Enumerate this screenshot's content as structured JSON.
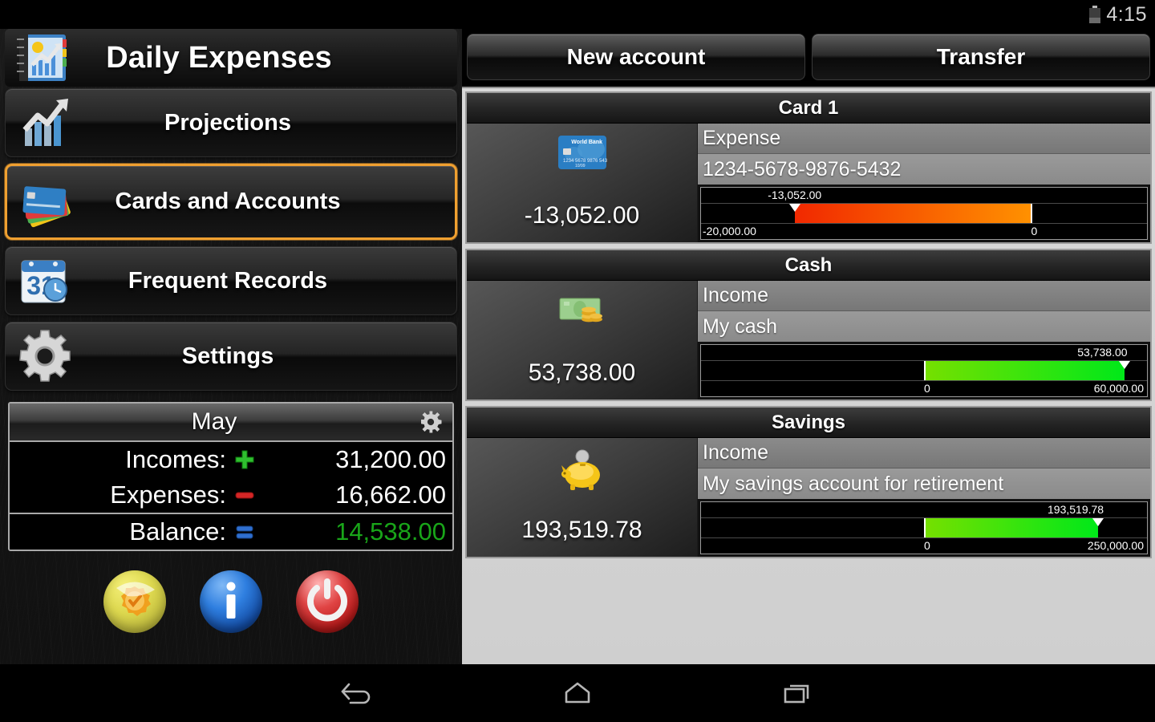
{
  "status_bar": {
    "time": "4:15",
    "battery_icon": "battery-icon"
  },
  "sidebar": {
    "app_title": "Daily Expenses",
    "app_icon": "notebook-chart-icon",
    "menu": [
      {
        "label": "Projections",
        "icon": "growth-chart-icon",
        "selected": false
      },
      {
        "label": "Cards and Accounts",
        "icon": "credit-cards-icon",
        "selected": true
      },
      {
        "label": "Frequent Records",
        "icon": "calendar-clock-icon",
        "selected": false
      },
      {
        "label": "Settings",
        "icon": "gear-icon",
        "selected": false
      }
    ],
    "summary": {
      "month": "May",
      "settings_icon": "gear-icon",
      "rows": [
        {
          "label": "Incomes:",
          "icon": "plus-green-icon",
          "value": "31,200.00",
          "color": "#ffffff"
        },
        {
          "label": "Expenses:",
          "icon": "minus-red-icon",
          "value": "16,662.00",
          "color": "#ffffff"
        },
        {
          "label": "Balance:",
          "icon": "equals-blue-icon",
          "value": "14,538.00",
          "color": "#19a519"
        }
      ]
    },
    "bottom_icons": [
      {
        "name": "rate-app-icon",
        "color": "#ddd84f"
      },
      {
        "name": "info-icon",
        "color": "#2f7fe0"
      },
      {
        "name": "power-exit-icon",
        "color": "#e04444"
      }
    ]
  },
  "main": {
    "buttons": {
      "new_account": "New account",
      "transfer": "Transfer"
    },
    "accounts": [
      {
        "title": "Card 1",
        "icon": "credit-card-icon",
        "balance": "-13,052.00",
        "type": "Expense",
        "description": "1234-5678-9876-5432",
        "gauge": {
          "value_label": "-13,052.00",
          "min_label": "-20,000.00",
          "max_label": "0",
          "min": -20000,
          "max": 0,
          "value": -13052,
          "zero_pos_pct": 74,
          "fill_start_pct": 21,
          "fill_end_pct": 74,
          "pointer_pct": 21,
          "fill_from": "#f12800",
          "fill_to": "#ff9100"
        }
      },
      {
        "title": "Cash",
        "icon": "cash-money-icon",
        "balance": "53,738.00",
        "type": "Income",
        "description": "My cash",
        "gauge": {
          "value_label": "53,738.00",
          "min_label": "0",
          "max_label": "60,000.00",
          "min": 0,
          "max": 60000,
          "value": 53738,
          "zero_pos_pct": 50,
          "fill_start_pct": 50,
          "fill_end_pct": 95,
          "pointer_pct": 95,
          "fill_from": "#76e000",
          "fill_to": "#00e819"
        }
      },
      {
        "title": "Savings",
        "icon": "piggy-bank-icon",
        "balance": "193,519.78",
        "type": "Income",
        "description": "My savings account for retirement",
        "gauge": {
          "value_label": "193,519.78",
          "min_label": "0",
          "max_label": "250,000.00",
          "min": 0,
          "max": 250000,
          "value": 193519.78,
          "zero_pos_pct": 50,
          "fill_start_pct": 50,
          "fill_end_pct": 89,
          "pointer_pct": 89,
          "fill_from": "#76e000",
          "fill_to": "#00e819"
        }
      }
    ]
  },
  "navbar": [
    {
      "name": "back-icon"
    },
    {
      "name": "home-icon"
    },
    {
      "name": "recent-apps-icon"
    }
  ]
}
